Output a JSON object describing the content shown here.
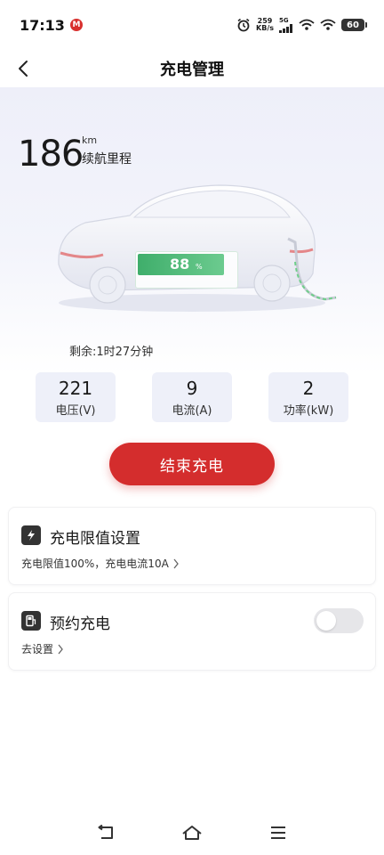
{
  "status_bar": {
    "time": "17:13",
    "app_badge": "M",
    "net_speed_value": "259",
    "net_speed_unit": "KB/s",
    "network_type": "5G",
    "battery_level": "60"
  },
  "header": {
    "title": "充电管理"
  },
  "hero": {
    "range_value": "186",
    "range_unit": "km",
    "range_label": "续航里程",
    "battery_percent": "88",
    "battery_percent_sign": "%",
    "battery_level": 0.88,
    "remaining_text": "剩余:1时27分钟"
  },
  "stats": [
    {
      "value": "221",
      "label": "电压(V)"
    },
    {
      "value": "9",
      "label": "电流(A)"
    },
    {
      "value": "2",
      "label": "功率(kW)"
    }
  ],
  "end_button_label": "结束充电",
  "limit_card": {
    "title": "充电限值设置",
    "subtitle": "充电限值100%，充电电流10A"
  },
  "reserve_card": {
    "title": "预约充电",
    "subtitle": "去设置",
    "toggle_on": false
  },
  "colors": {
    "accent_red": "#d42d2d",
    "battery_green": "#3fae6b",
    "stat_card_bg": "#eef0f9"
  }
}
